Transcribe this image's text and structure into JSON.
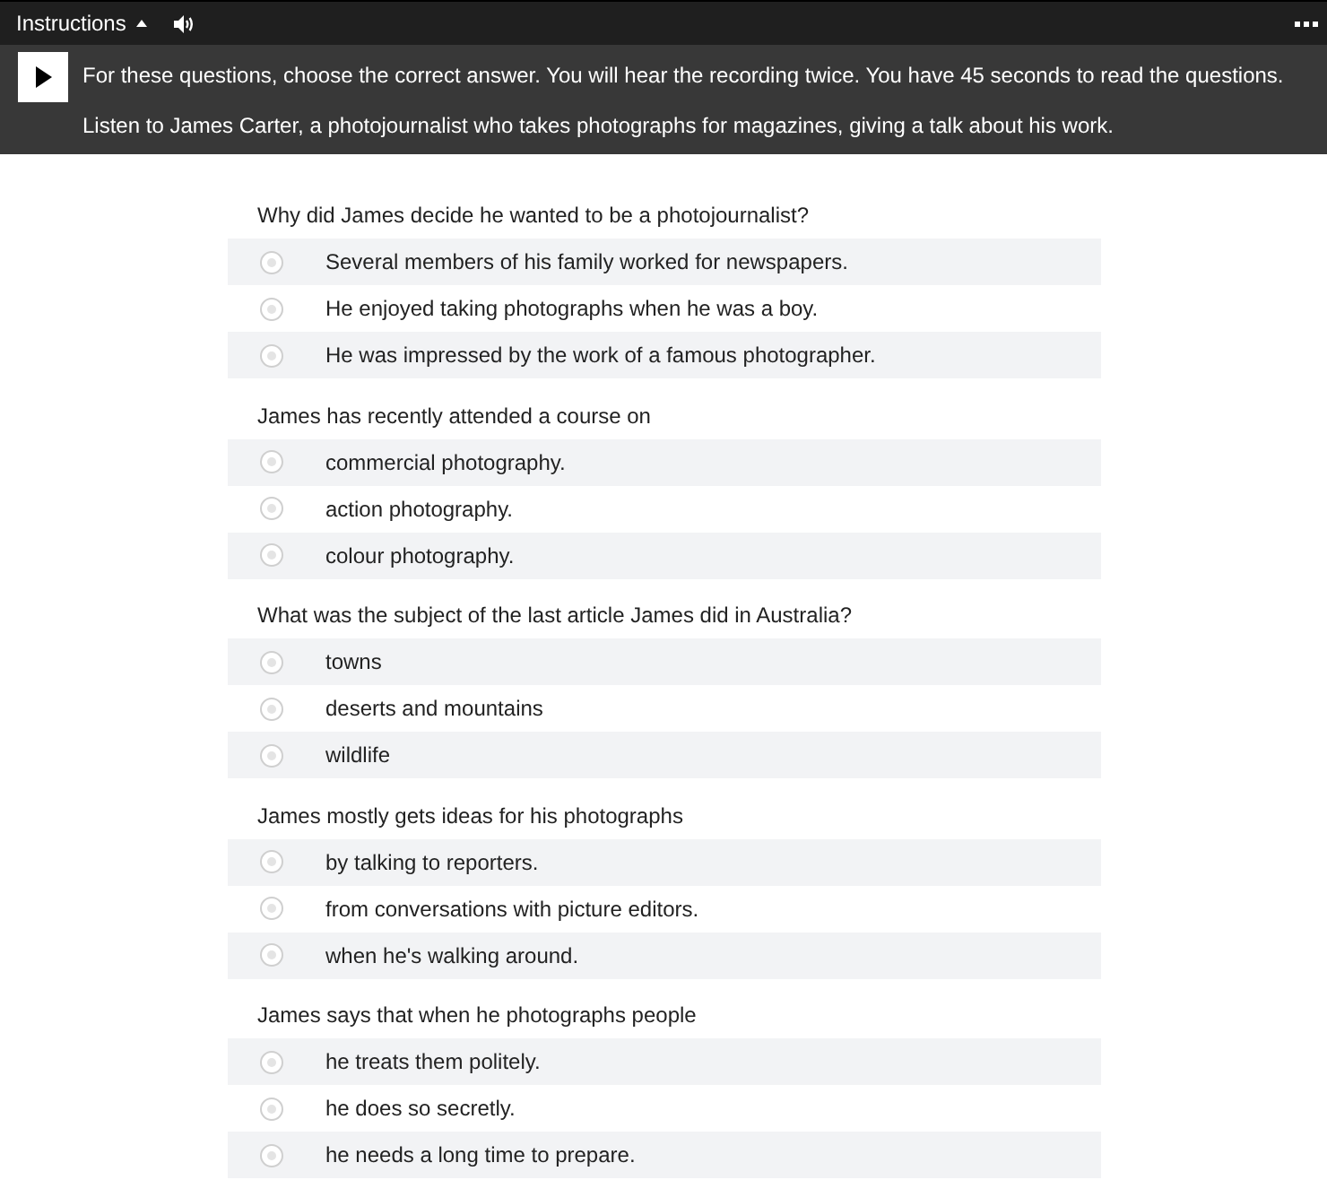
{
  "header": {
    "title": "Instructions",
    "expanded": true
  },
  "instructions": {
    "lines": [
      "For these questions, choose the correct answer. You will hear the recording twice. You have 45 seconds to read the questions.",
      "Listen to James Carter, a photojournalist who takes photographs for magazines, giving a talk about his work."
    ]
  },
  "questions": [
    {
      "prompt": "Why did James decide he wanted to be a photojournalist?",
      "options": [
        {
          "text": "Several members of his family worked for newspapers.",
          "selected": false
        },
        {
          "text": "He enjoyed taking photographs when he was a boy.",
          "selected": false
        },
        {
          "text": "He was impressed by the work of a famous photographer.",
          "selected": false
        }
      ]
    },
    {
      "prompt": "James has recently attended a course on",
      "options": [
        {
          "text": "commercial photography.",
          "selected": false
        },
        {
          "text": "action photography.",
          "selected": false
        },
        {
          "text": "colour photography.",
          "selected": false
        }
      ]
    },
    {
      "prompt": "What was the subject of the last article James did in Australia?",
      "options": [
        {
          "text": "towns",
          "selected": false
        },
        {
          "text": "deserts and mountains",
          "selected": false
        },
        {
          "text": "wildlife",
          "selected": false
        }
      ]
    },
    {
      "prompt": "James mostly gets ideas for his photographs",
      "options": [
        {
          "text": "by talking to reporters.",
          "selected": false
        },
        {
          "text": "from conversations with picture editors.",
          "selected": false
        },
        {
          "text": "when he's walking around.",
          "selected": false
        }
      ]
    },
    {
      "prompt": "James says that when he photographs people",
      "options": [
        {
          "text": "he treats them politely.",
          "selected": false
        },
        {
          "text": "he does so secretly.",
          "selected": false
        },
        {
          "text": "he needs a long time to prepare.",
          "selected": false
        }
      ]
    }
  ]
}
